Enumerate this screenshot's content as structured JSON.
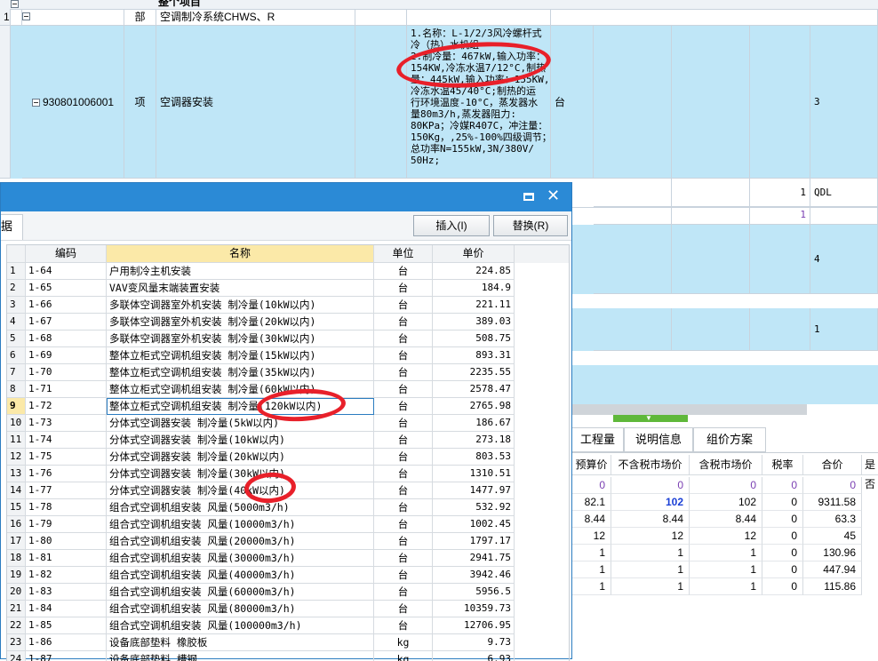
{
  "background": {
    "header_cut_text": "整个项目",
    "row1": {
      "num": "1",
      "type": "部",
      "name": "空调制冷系统CHWS、R"
    },
    "row2": {
      "code": "930801006001",
      "type": "项",
      "name": "空调器安装",
      "desc_lines": [
        "1.名称：L-1/2/3风冷螺杆式",
        "冷（热）水机组",
        "2.制冷量：467kW,输入功率：",
        "154KW,冷冻水温7/12°C,制热",
        "量：445kW,输入功率：155KW,",
        "冷冻水温45/40°C;制热的运",
        "行环境温度-10°C，蒸发器水",
        "量80m3/h,蒸发器阻力:",
        "80KPa；冷媒R407C，冲注量：",
        "150Kg，,25%-100%四级调节；",
        "总功率N=155kW,3N/380V/",
        "50Hz;"
      ],
      "unit": "台",
      "qty": "3"
    },
    "row3": {
      "num": "1",
      "code": "QDL"
    },
    "row4": {
      "num": "1"
    },
    "row5": {
      "qty": "4"
    },
    "row6": {
      "qty": "1"
    }
  },
  "dialog": {
    "left_tab_fragment": "据",
    "insert_button": "插入(I)",
    "replace_button": "替换(R)",
    "columns": {
      "code": "编码",
      "name": "名称",
      "unit": "单位",
      "price": "单价"
    },
    "rows": [
      {
        "n": "1",
        "code": "1-64",
        "name": "户用制冷主机安装",
        "unit": "台",
        "price": "224.85"
      },
      {
        "n": "2",
        "code": "1-65",
        "name": "VAV变风量末端装置安装",
        "unit": "台",
        "price": "184.9"
      },
      {
        "n": "3",
        "code": "1-66",
        "name": "多联体空调器室外机安装 制冷量(10kW以内)",
        "unit": "台",
        "price": "221.11"
      },
      {
        "n": "4",
        "code": "1-67",
        "name": "多联体空调器室外机安装 制冷量(20kW以内)",
        "unit": "台",
        "price": "389.03"
      },
      {
        "n": "5",
        "code": "1-68",
        "name": "多联体空调器室外机安装 制冷量(30kW以内)",
        "unit": "台",
        "price": "508.75"
      },
      {
        "n": "6",
        "code": "1-69",
        "name": "整体立柜式空调机组安装 制冷量(15kW以内)",
        "unit": "台",
        "price": "893.31"
      },
      {
        "n": "7",
        "code": "1-70",
        "name": "整体立柜式空调机组安装 制冷量(35kW以内)",
        "unit": "台",
        "price": "2235.55"
      },
      {
        "n": "8",
        "code": "1-71",
        "name": "整体立柜式空调机组安装 制冷量(60kW以内)",
        "unit": "台",
        "price": "2578.47"
      },
      {
        "n": "9",
        "code": "1-72",
        "name": "整体立柜式空调机组安装 制冷量(120kW以内)",
        "unit": "台",
        "price": "2765.98"
      },
      {
        "n": "10",
        "code": "1-73",
        "name": "分体式空调器安装 制冷量(5kW以内)",
        "unit": "台",
        "price": "186.67"
      },
      {
        "n": "11",
        "code": "1-74",
        "name": "分体式空调器安装 制冷量(10kW以内)",
        "unit": "台",
        "price": "273.18"
      },
      {
        "n": "12",
        "code": "1-75",
        "name": "分体式空调器安装 制冷量(20kW以内)",
        "unit": "台",
        "price": "803.53"
      },
      {
        "n": "13",
        "code": "1-76",
        "name": "分体式空调器安装 制冷量(30kW以内)",
        "unit": "台",
        "price": "1310.51"
      },
      {
        "n": "14",
        "code": "1-77",
        "name": "分体式空调器安装 制冷量(40kW以内)",
        "unit": "台",
        "price": "1477.97"
      },
      {
        "n": "15",
        "code": "1-78",
        "name": "组合式空调机组安装 风量(5000m3/h)",
        "unit": "台",
        "price": "532.92"
      },
      {
        "n": "16",
        "code": "1-79",
        "name": "组合式空调机组安装 风量(10000m3/h)",
        "unit": "台",
        "price": "1002.45"
      },
      {
        "n": "17",
        "code": "1-80",
        "name": "组合式空调机组安装 风量(20000m3/h)",
        "unit": "台",
        "price": "1797.17"
      },
      {
        "n": "18",
        "code": "1-81",
        "name": "组合式空调机组安装 风量(30000m3/h)",
        "unit": "台",
        "price": "2941.75"
      },
      {
        "n": "19",
        "code": "1-82",
        "name": "组合式空调机组安装 风量(40000m3/h)",
        "unit": "台",
        "price": "3942.46"
      },
      {
        "n": "20",
        "code": "1-83",
        "name": "组合式空调机组安装 风量(60000m3/h)",
        "unit": "台",
        "price": "5956.5"
      },
      {
        "n": "21",
        "code": "1-84",
        "name": "组合式空调机组安装 风量(80000m3/h)",
        "unit": "台",
        "price": "10359.73"
      },
      {
        "n": "22",
        "code": "1-85",
        "name": "组合式空调机组安装 风量(100000m3/h)",
        "unit": "台",
        "price": "12706.95"
      },
      {
        "n": "23",
        "code": "1-86",
        "name": "设备底部垫料 橡胶板",
        "unit": "kg",
        "price": "9.73"
      },
      {
        "n": "24",
        "code": "1-87",
        "name": "设备底部垫料 槽钢",
        "unit": "kg",
        "price": "6.93"
      }
    ],
    "selected_row": 8
  },
  "right_panel": {
    "tabs": [
      "工程量",
      "说明信息",
      "组价方案"
    ],
    "headers": [
      "预算价",
      "不含税市场价",
      "含税市场价",
      "税率",
      "合价",
      "是否"
    ],
    "rows": [
      [
        "0",
        "0",
        "0",
        "0",
        "0"
      ],
      [
        "82.1",
        "102",
        "102",
        "0",
        "9311.58"
      ],
      [
        "8.44",
        "8.44",
        "8.44",
        "0",
        "63.3"
      ],
      [
        "12",
        "12",
        "12",
        "0",
        "45"
      ],
      [
        "1",
        "1",
        "1",
        "0",
        "130.96"
      ],
      [
        "1",
        "1",
        "1",
        "0",
        "447.94"
      ],
      [
        "1",
        "1",
        "1",
        "0",
        "115.86"
      ]
    ]
  },
  "colors": {
    "row_blue": "#bfe6f7",
    "titlebar": "#2b8ad6",
    "highlight": "#e8202a",
    "purple": "#7a3fb2"
  }
}
